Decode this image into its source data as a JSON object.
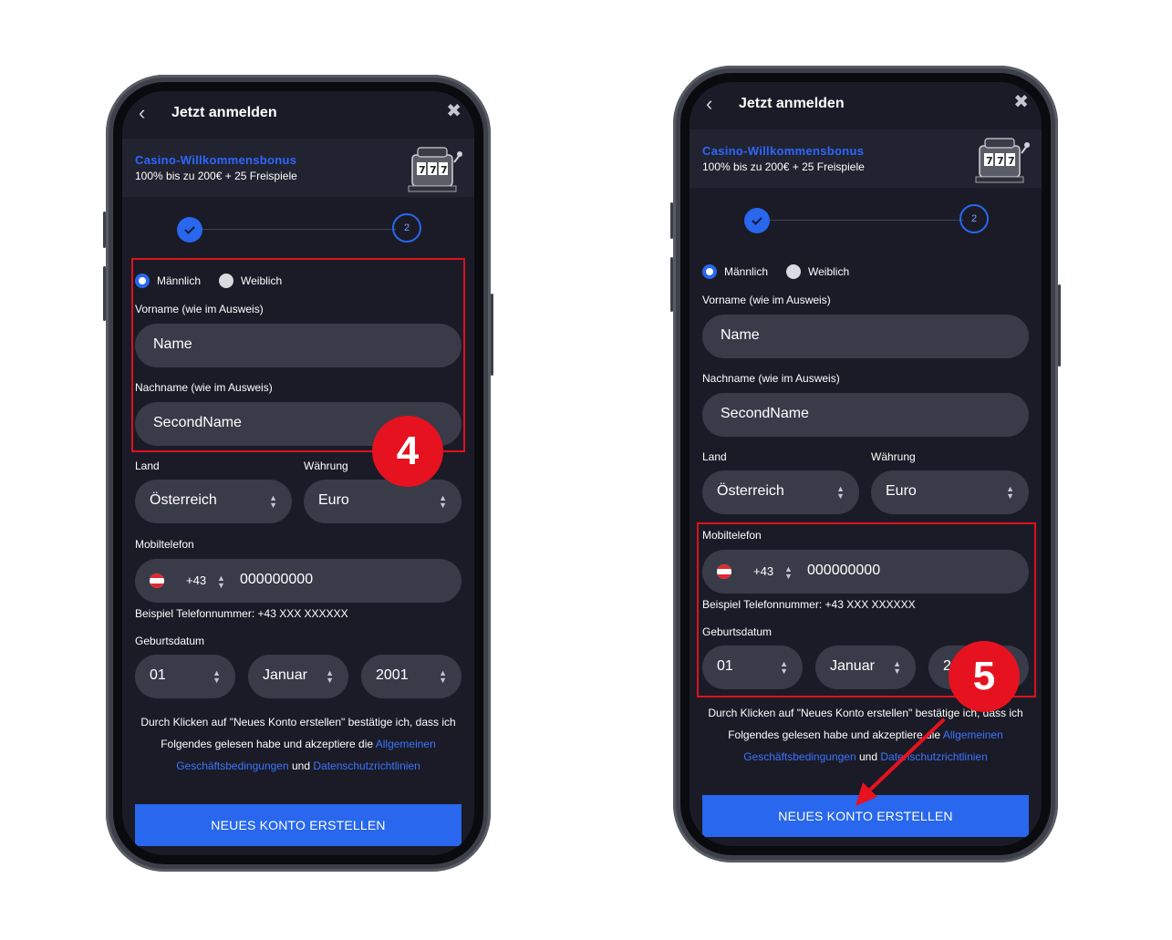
{
  "form": {
    "title": "Jetzt anmelden",
    "bonus_title": "Casino-Willkommensbonus",
    "bonus_subtitle": "100% bis zu 200€ + 25 Freispiele",
    "step_two": "2",
    "gender_male": "Männlich",
    "gender_female": "Weiblich",
    "firstname_label": "Vorname (wie im Ausweis)",
    "firstname_value": "Name",
    "lastname_label": "Nachname (wie im Ausweis)",
    "lastname_value": "SecondName",
    "country_label": "Land",
    "country_value": "Österreich",
    "currency_label": "Währung",
    "currency_value": "Euro",
    "mobile_label": "Mobiltelefon",
    "mobile_prefix": "+43",
    "mobile_value": "000000000",
    "mobile_hint": "Beispiel Telefonnummer: +43 XXX XXXXXX",
    "birthdate_label": "Geburtsdatum",
    "birth_day": "01",
    "birth_month": "Januar",
    "birth_year": "2001",
    "terms_text_1": "Durch Klicken auf \"Neues Konto erstellen\" bestätige ich, dass ich Folgendes gelesen habe und akzeptiere die ",
    "terms_link_1": "Allgemeinen Geschäftsbedingungen",
    "terms_and": " und ",
    "terms_link_2": "Datenschutzrichtlinien",
    "submit_label": "NEUES KONTO ERSTELLEN"
  },
  "annotations": {
    "step_4": "4",
    "step_5": "5"
  },
  "colors": {
    "background": "#1a1b26",
    "accent": "#2867ee",
    "link": "#3d74ff",
    "highlight": "#e0101e"
  },
  "icons": [
    "back-chevron-icon",
    "close-icon",
    "slot-machine-icon",
    "check-icon",
    "select-arrows-icon",
    "austria-flag-icon"
  ]
}
